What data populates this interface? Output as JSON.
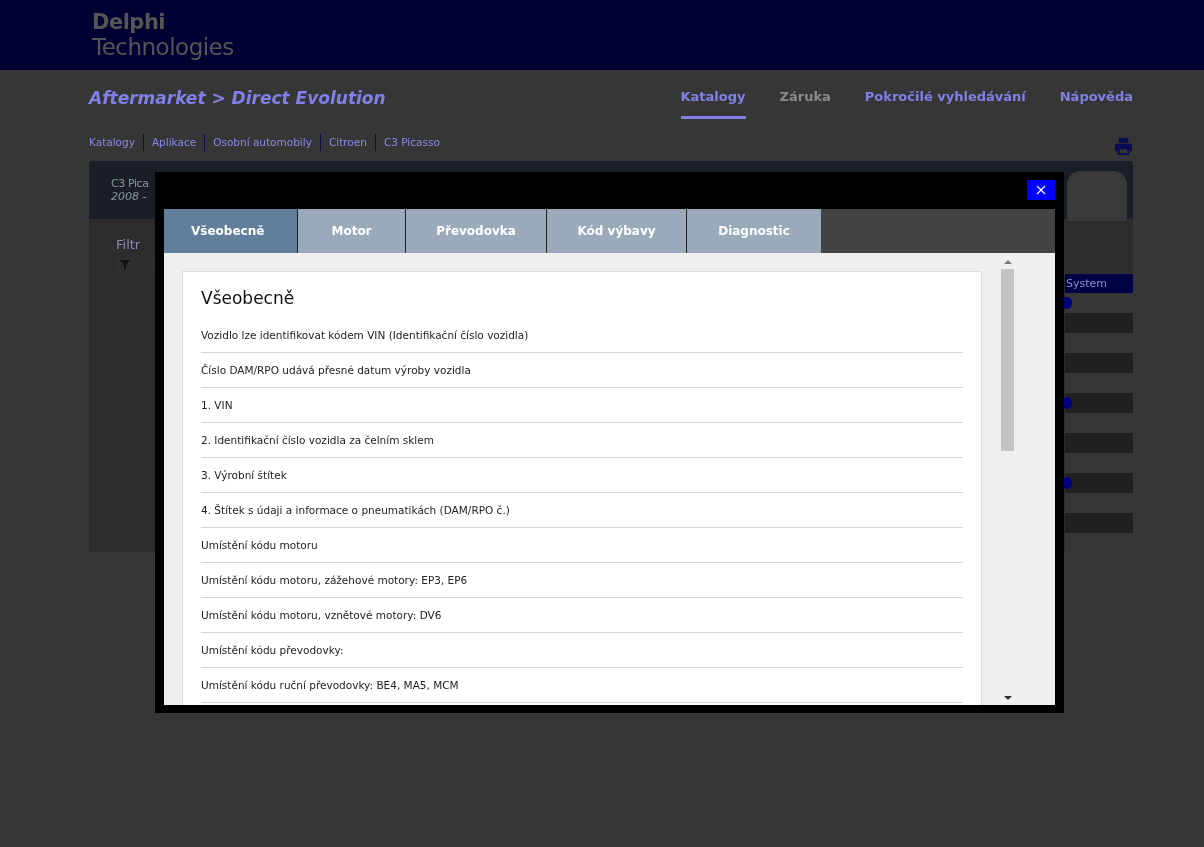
{
  "header": {
    "logo_line_1": "Delphi",
    "logo_line_2": "Technologies"
  },
  "page_title": "Aftermarket > Direct Evolution",
  "nav": [
    {
      "label": "Katalogy",
      "selected": true,
      "disabled": false
    },
    {
      "label": "Záruka",
      "selected": false,
      "disabled": true
    },
    {
      "label": "Pokročilé vyhledávání",
      "selected": false,
      "disabled": false
    },
    {
      "label": "Nápověda",
      "selected": false,
      "disabled": false
    }
  ],
  "breadcrumbs": [
    "Katalogy",
    "Aplikace",
    "Osobní automobily",
    "Citroen",
    "C3 Picasso"
  ],
  "vehicle_card": {
    "name": "C3 Pica",
    "years": "2008 -"
  },
  "filter": {
    "label": "Filtr"
  },
  "table": {
    "column_header": "System",
    "rows": [
      {
        "marker": true
      },
      {
        "marker": false
      },
      {
        "marker": false
      },
      {
        "marker": false
      },
      {
        "marker": false
      },
      {
        "marker": true
      },
      {
        "marker": false
      },
      {
        "marker": false
      },
      {
        "marker": false
      },
      {
        "marker": true
      },
      {
        "marker": false
      },
      {
        "marker": false
      },
      {
        "marker": false
      }
    ]
  },
  "modal": {
    "tabs": [
      {
        "label": "Všeobecně",
        "selected": true
      },
      {
        "label": "Motor",
        "selected": false
      },
      {
        "label": "Převodovka",
        "selected": false
      },
      {
        "label": "Kód výbavy",
        "selected": false
      },
      {
        "label": "Diagnostic",
        "selected": false
      }
    ],
    "heading": "Všeobecně",
    "items": [
      "Vozidlo lze identifikovat kódem VIN (Identifikační číslo vozidla)",
      "Číslo DAM/RPO udává přesné datum výroby vozidla",
      "1. VIN",
      "2. Identifikační číslo vozidla za čelním sklem",
      "3. Výrobní štítek",
      "4. Štítek s údaji a informace o pneumatikách (DAM/RPO č.)",
      "Umístění kódu motoru",
      "Umístění kódu motoru, zážehové motory: EP3, EP6",
      "Umístění kódu motoru, vznětové motory: DV6",
      "Umístění kódu převodovky:",
      "Umístění kódu ruční převodovky: BE4, MA5, MCM"
    ]
  }
}
